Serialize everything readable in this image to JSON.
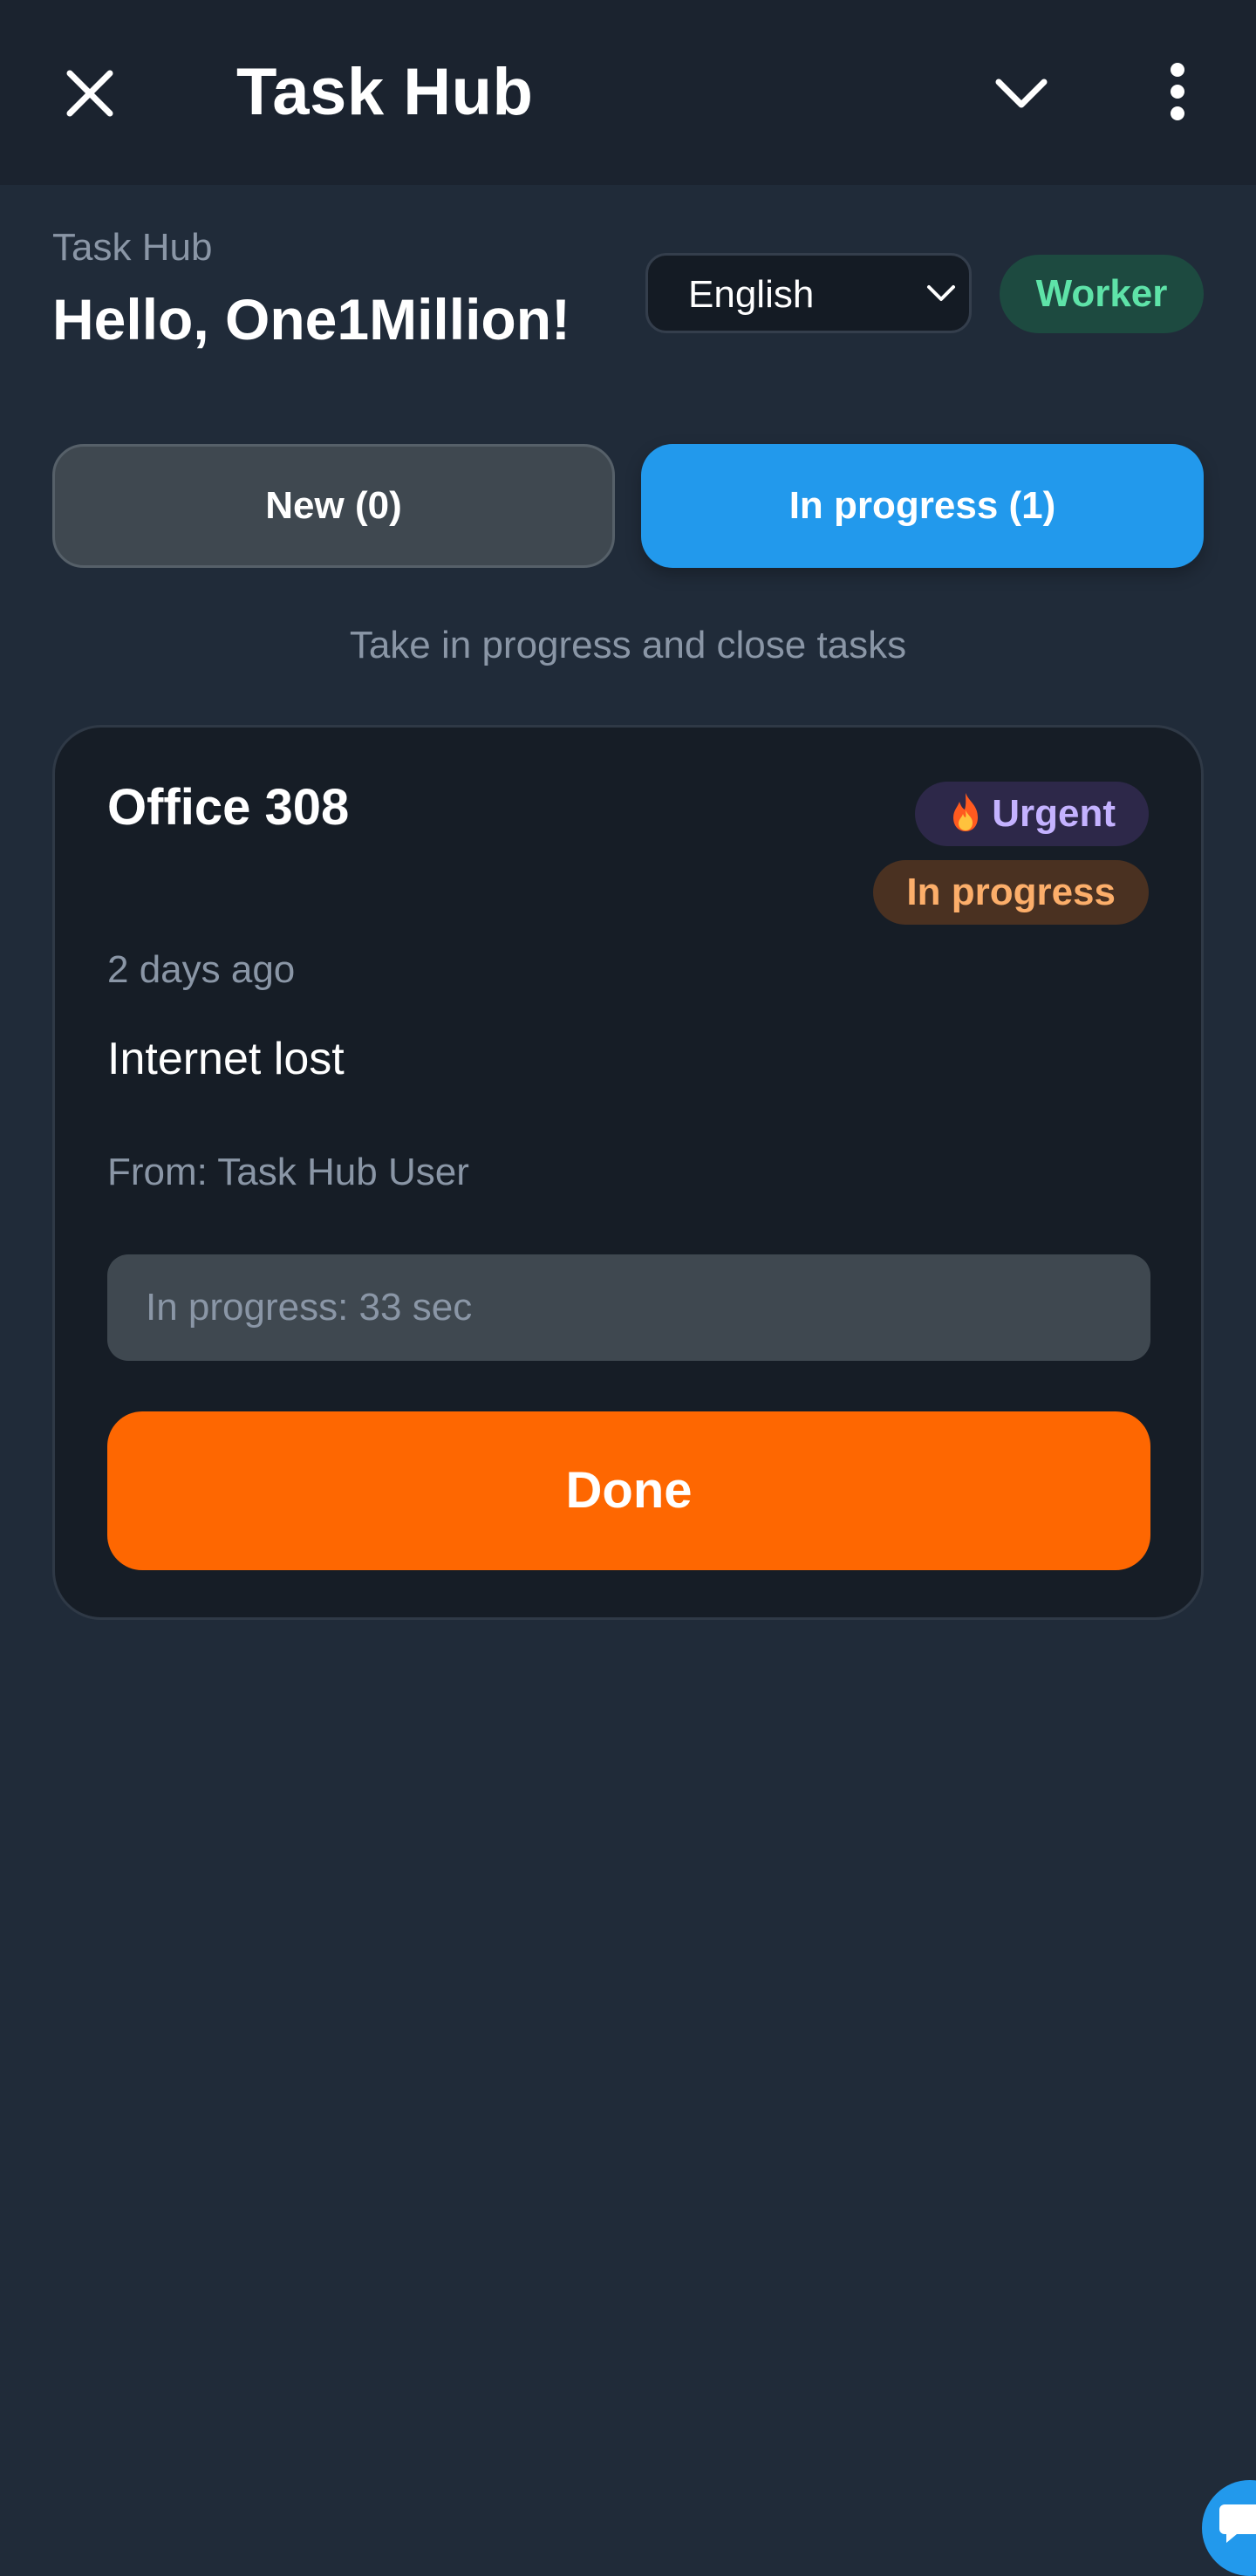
{
  "header": {
    "title": "Task Hub",
    "close_icon": "close-icon",
    "dropdown_icon": "chevron-down-icon",
    "menu_icon": "more-vertical-icon"
  },
  "greeting": {
    "app_label": "Task Hub",
    "text": "Hello, One1Million!"
  },
  "language": {
    "selected": "English"
  },
  "role": {
    "label": "Worker"
  },
  "tabs": [
    {
      "label": "New (0)",
      "active": false
    },
    {
      "label": "In progress (1)",
      "active": true
    }
  ],
  "subtitle": "Take in progress and close tasks",
  "task": {
    "location": "Office 308",
    "priority_icon": "fire-icon",
    "priority": "Urgent",
    "status": "In progress",
    "time_ago": "2 days ago",
    "description": "Internet lost",
    "from": "From: Task Hub User",
    "timer": "In progress: 33 sec",
    "done_label": "Done"
  },
  "colors": {
    "background": "#202b39",
    "topbar": "#1b232f",
    "card": "#161d26",
    "accent_blue": "#2299ec",
    "done_orange": "#fe6701",
    "worker_green": "#5ee3a8",
    "urgent_purple": "#c4b2ff",
    "status_orange": "#fcae6a"
  }
}
